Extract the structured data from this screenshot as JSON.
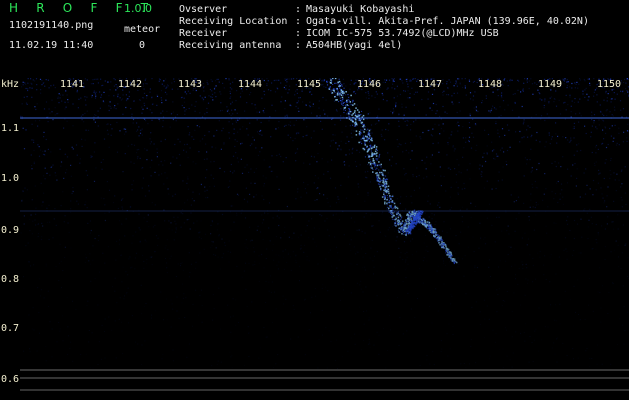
{
  "app": {
    "name": "H R O F F T",
    "version": "1.0.0"
  },
  "file": {
    "name": "1102191140.png",
    "datetime": "11.02.19 11:40"
  },
  "meteor": {
    "label": "meteor",
    "count": "0"
  },
  "info": {
    "observer_label": "Ovserver",
    "observer_value": "Masayuki Kobayashi",
    "location_label": "Receiving Location",
    "location_value": "Ogata-vill. Akita-Pref. JAPAN (139.96E, 40.02N)",
    "receiver_label": "Receiver",
    "receiver_value": "ICOM IC-575 53.7492(@LCD)MHz USB",
    "antenna_label": "Receiving antenna",
    "antenna_value": "A504HB(yagi 4el)",
    "separator": ":"
  },
  "spectrum": {
    "unit": "kHz",
    "time_ticks": [
      "1141",
      "1142",
      "1143",
      "1144",
      "1145",
      "1146",
      "1147",
      "1148",
      "1149",
      "1150"
    ],
    "freq_ticks": [
      "1.1",
      "1.0",
      "0.9",
      "0.8",
      "0.7",
      "0.6"
    ]
  },
  "colors": {
    "logo": "#2ce75a",
    "text": "#ececec",
    "tick_text": "#f4f0d0",
    "noise": "#2d56ff",
    "noise_dim": "#112a9b",
    "signal": "#8fd2ff",
    "reference_line": "#d7d7d7",
    "frequency_line": "#4b7dff"
  }
}
